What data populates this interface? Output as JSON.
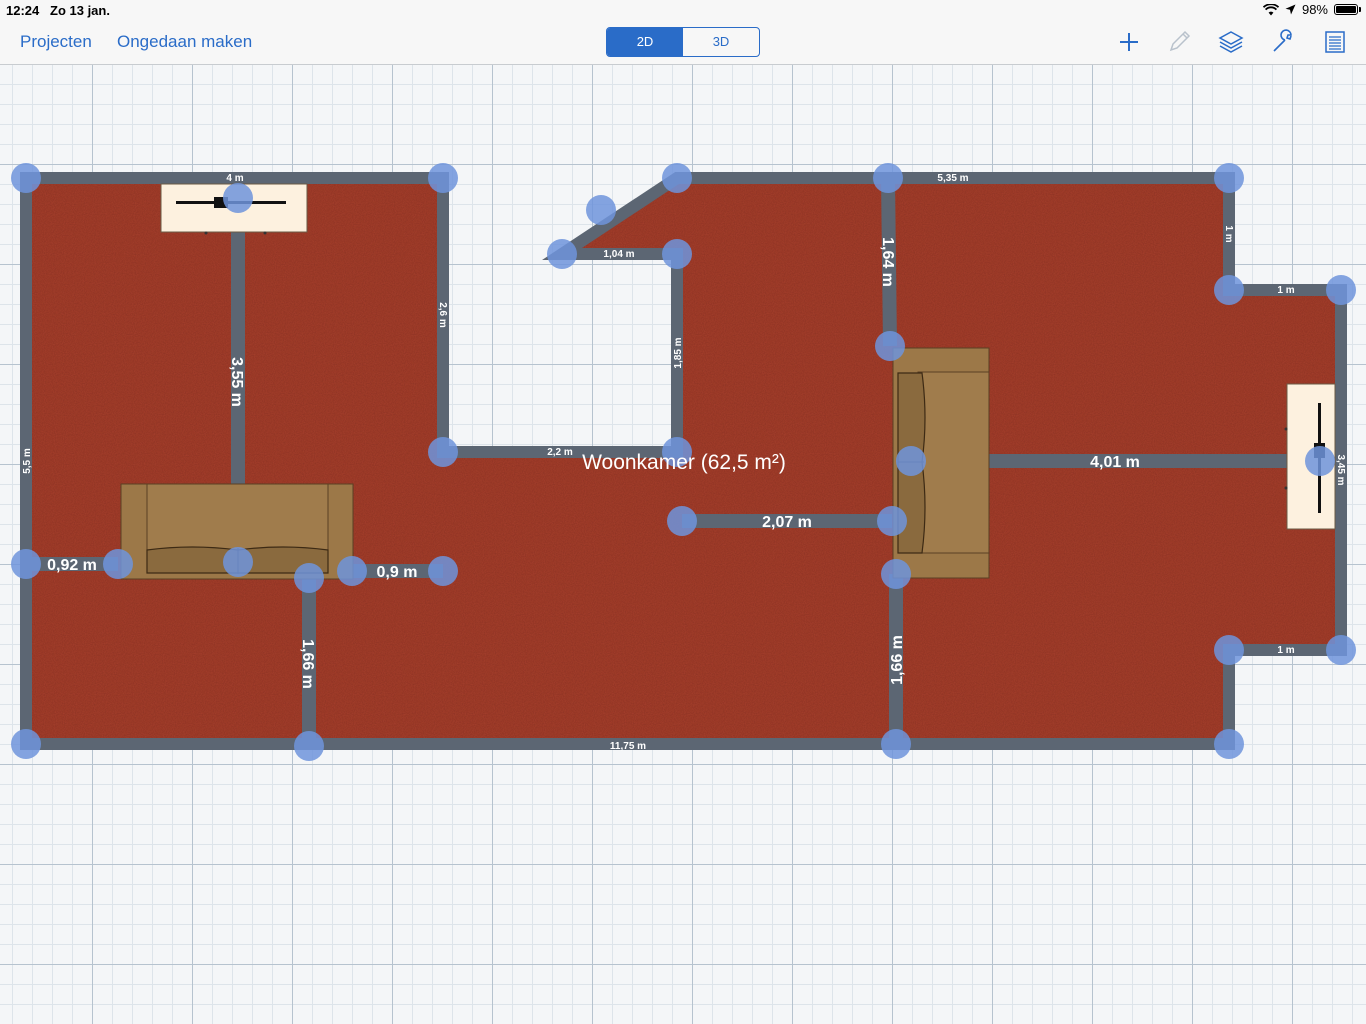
{
  "status_bar": {
    "time": "12:24",
    "date": "Zo 13 jan.",
    "battery": "98%",
    "battery_level": 0.98
  },
  "nav": {
    "projects_label": "Projecten",
    "undo_label": "Ongedaan maken",
    "view_2d_label": "2D",
    "view_3d_label": "3D",
    "active_view": "2D",
    "icons": [
      "plus-icon",
      "pencil-icon",
      "layers-icon",
      "wrench-icon",
      "list-icon"
    ]
  },
  "colors": {
    "accent": "#2a6cc8",
    "floor": "#a8412f",
    "wall": "#5c6673",
    "handle": "#6e94dc",
    "sofa": "#9c7848"
  },
  "floorplan": {
    "room_label": "Woonkamer (62,5 m²)",
    "dimension_labels": {
      "top_left_wall": "4 m",
      "top_right_wall": "5,35 m",
      "bottom_wall": "11,75 m",
      "left_wall": "5,5 m",
      "inner_vertical_left": "2,6 m",
      "inner_horizontal_bottom": "2,2 m",
      "inner_vertical_right": "1,85 m",
      "notch_top": "1,04 m",
      "right_top_vertical": "1 m",
      "right_bump_top": "1 m",
      "right_bump_vertical": "3,45 m",
      "right_bump_bottom": "1 m",
      "measure_vertical_left": "3,55 m",
      "measure_horizontal_left": "0,92 m",
      "measure_horizontal_mid": "0,9 m",
      "measure_vertical_bottom_left": "1,66 m",
      "measure_horizontal_center": "2,07 m",
      "measure_vertical_top_right": "1,64 m",
      "measure_vertical_bottom_right": "1,66 m",
      "measure_horizontal_right": "4,01 m"
    }
  }
}
